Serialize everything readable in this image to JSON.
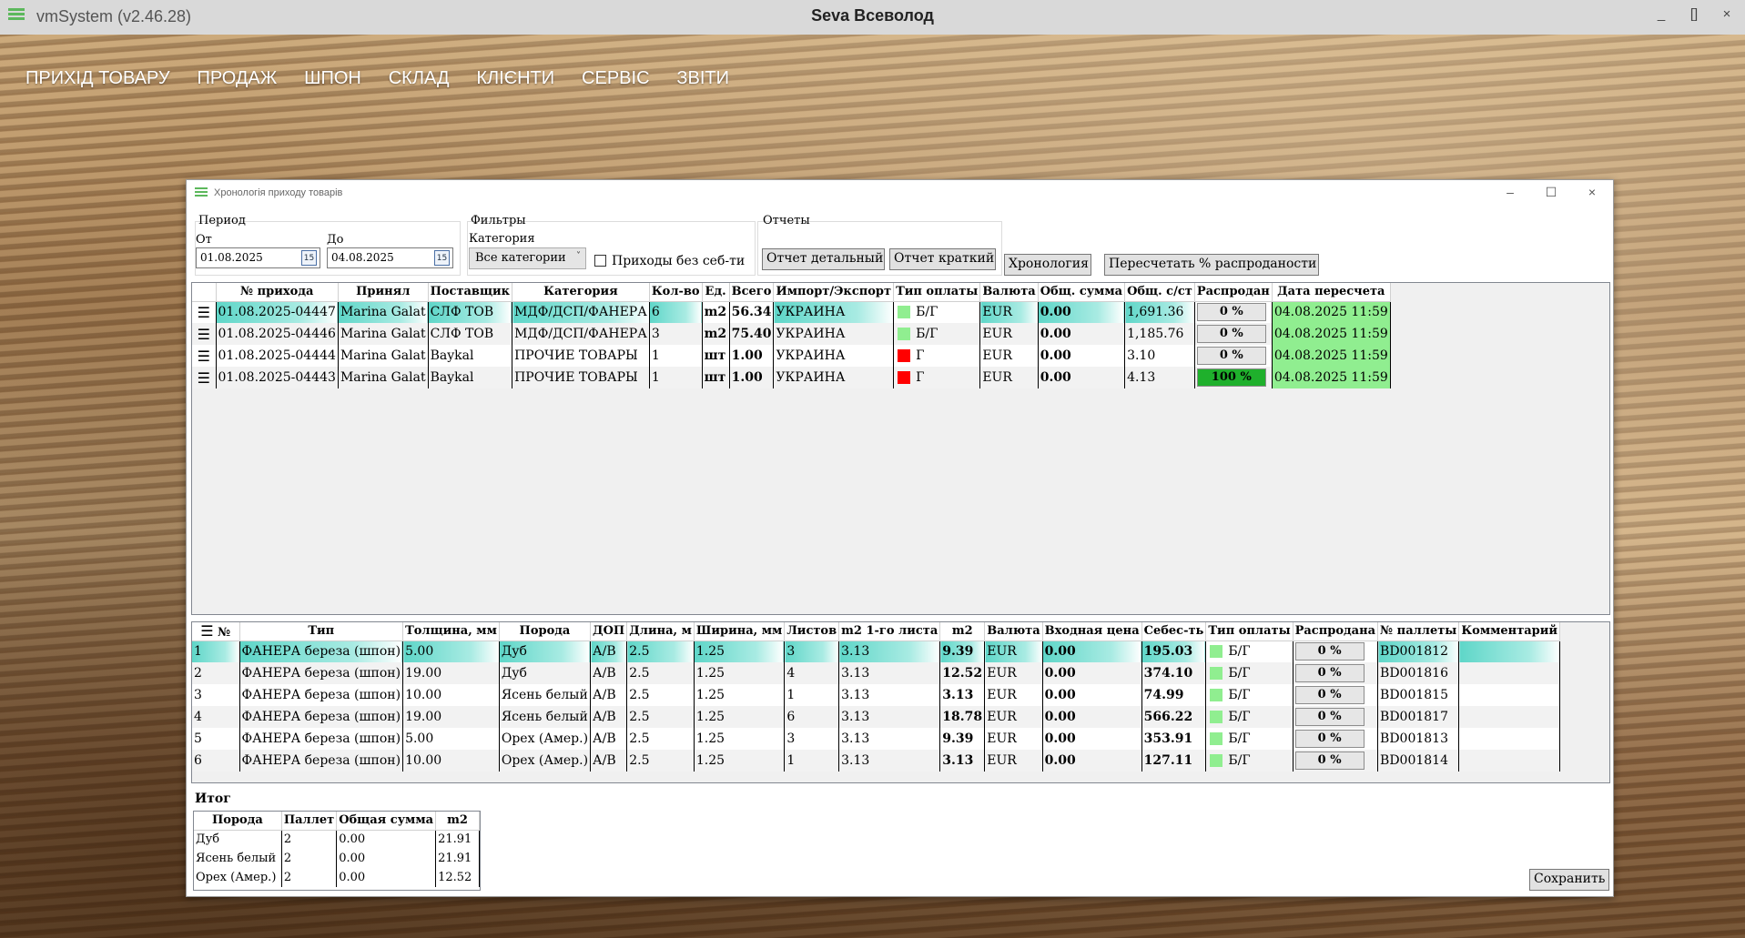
{
  "titlebar": {
    "app_title": "vmSystem (v2.46.28)",
    "user": "Seva Всеволод",
    "minimize": "_",
    "restore": "[]",
    "close": "×"
  },
  "nav": [
    "ПРИХІД ТОВАРУ",
    "ПРОДАЖ",
    "ШПОН",
    "СКЛАД",
    "КЛІЄНТИ",
    "СЕРВІС",
    "ЗВІТИ"
  ],
  "window": {
    "title": "Хронологія приходу товарів",
    "minimize": "–",
    "maximize": "☐",
    "close": "×"
  },
  "period": {
    "label": "Период",
    "from_label": "От",
    "from_value": "01.08.2025",
    "to_label": "До",
    "to_value": "04.08.2025",
    "calendar_icon_text": "15"
  },
  "filters": {
    "label": "Фильтры",
    "category_label": "Категория",
    "category_value": "Все категории",
    "no_cost_label": "Приходы без себ-ти"
  },
  "reports": {
    "label": "Отчеты",
    "detailed": "Отчет детальный",
    "brief": "Отчет краткий"
  },
  "buttons": {
    "chronology": "Хронология",
    "recalc": "Пересчетать % распроданости",
    "save": "Сохранить"
  },
  "receipts": {
    "columns": [
      "№ прихода",
      "Принял",
      "Поставщик",
      "Категория",
      "Кол-во",
      "Ед.",
      "Всего",
      "Импорт/Экспорт",
      "Тип оплаты",
      "Валюта",
      "Общ. сумма",
      "Общ. с/ст",
      "Распродан",
      "Дата пересчета"
    ],
    "rows": [
      {
        "id": "01.08.2025-04447",
        "accepted": "Marina Galat",
        "supplier": "СЛФ ТОВ",
        "category": "МДФ/ДСП/ФАНЕРА",
        "qty": "6",
        "unit": "m2",
        "total": "56.34",
        "ie": "УКРАИНА",
        "pay_color": "#90ee90",
        "pay": "Б/Г",
        "currency": "EUR",
        "sum": "0.00",
        "cost": "1,691.36",
        "sold": "0 %",
        "recalc": "04.08.2025 11:59"
      },
      {
        "id": "01.08.2025-04446",
        "accepted": "Marina Galat",
        "supplier": "СЛФ ТОВ",
        "category": "МДФ/ДСП/ФАНЕРА",
        "qty": "3",
        "unit": "m2",
        "total": "75.40",
        "ie": "УКРАИНА",
        "pay_color": "#90ee90",
        "pay": "Б/Г",
        "currency": "EUR",
        "sum": "0.00",
        "cost": "1,185.76",
        "sold": "0 %",
        "recalc": "04.08.2025 11:59"
      },
      {
        "id": "01.08.2025-04444",
        "accepted": "Marina Galat",
        "supplier": "Baykal",
        "category": "ПРОЧИЕ ТОВАРЫ",
        "qty": "1",
        "unit": "шт",
        "total": "1.00",
        "ie": "УКРАИНА",
        "pay_color": "#ff0000",
        "pay": "Г",
        "currency": "EUR",
        "sum": "0.00",
        "cost": "3.10",
        "sold": "0 %",
        "recalc": "04.08.2025 11:59"
      },
      {
        "id": "01.08.2025-04443",
        "accepted": "Marina Galat",
        "supplier": "Baykal",
        "category": "ПРОЧИЕ ТОВАРЫ",
        "qty": "1",
        "unit": "шт",
        "total": "1.00",
        "ie": "УКРАИНА",
        "pay_color": "#ff0000",
        "pay": "Г",
        "currency": "EUR",
        "sum": "0.00",
        "cost": "4.13",
        "sold": "100 %",
        "recalc": "04.08.2025 11:59"
      }
    ]
  },
  "items": {
    "columns": [
      "№",
      "Тип",
      "Толщина, мм",
      "Порода",
      "ДОП",
      "Длина, м",
      "Ширина, мм",
      "Листов",
      "m2 1-го листа",
      "m2",
      "Валюта",
      "Входная цена",
      "Себес-ть",
      "Тип оплаты",
      "Распродана",
      "№ паллеты",
      "Комментарий"
    ],
    "rows": [
      {
        "n": "1",
        "type": "ФАНЕРА береза (шпон)",
        "thick": "5.00",
        "species": "Дуб",
        "dop": "А/В",
        "len": "2.5",
        "width": "1.25",
        "sheets": "3",
        "m2one": "3.13",
        "m2": "9.39",
        "currency": "EUR",
        "price": "0.00",
        "cost": "195.03",
        "pay": "Б/Г",
        "sold": "0 %",
        "pallet": "BD001812",
        "comment": ""
      },
      {
        "n": "2",
        "type": "ФАНЕРА береза (шпон)",
        "thick": "19.00",
        "species": "Дуб",
        "dop": "А/В",
        "len": "2.5",
        "width": "1.25",
        "sheets": "4",
        "m2one": "3.13",
        "m2": "12.52",
        "currency": "EUR",
        "price": "0.00",
        "cost": "374.10",
        "pay": "Б/Г",
        "sold": "0 %",
        "pallet": "BD001816",
        "comment": ""
      },
      {
        "n": "3",
        "type": "ФАНЕРА береза (шпон)",
        "thick": "10.00",
        "species": "Ясень белый",
        "dop": "А/В",
        "len": "2.5",
        "width": "1.25",
        "sheets": "1",
        "m2one": "3.13",
        "m2": "3.13",
        "currency": "EUR",
        "price": "0.00",
        "cost": "74.99",
        "pay": "Б/Г",
        "sold": "0 %",
        "pallet": "BD001815",
        "comment": ""
      },
      {
        "n": "4",
        "type": "ФАНЕРА береза (шпон)",
        "thick": "19.00",
        "species": "Ясень белый",
        "dop": "А/В",
        "len": "2.5",
        "width": "1.25",
        "sheets": "6",
        "m2one": "3.13",
        "m2": "18.78",
        "currency": "EUR",
        "price": "0.00",
        "cost": "566.22",
        "pay": "Б/Г",
        "sold": "0 %",
        "pallet": "BD001817",
        "comment": ""
      },
      {
        "n": "5",
        "type": "ФАНЕРА береза (шпон)",
        "thick": "5.00",
        "species": "Орех (Амер.)",
        "dop": "А/В",
        "len": "2.5",
        "width": "1.25",
        "sheets": "3",
        "m2one": "3.13",
        "m2": "9.39",
        "currency": "EUR",
        "price": "0.00",
        "cost": "353.91",
        "pay": "Б/Г",
        "sold": "0 %",
        "pallet": "BD001813",
        "comment": ""
      },
      {
        "n": "6",
        "type": "ФАНЕРА береза (шпон)",
        "thick": "10.00",
        "species": "Орех (Амер.)",
        "dop": "А/В",
        "len": "2.5",
        "width": "1.25",
        "sheets": "1",
        "m2one": "3.13",
        "m2": "3.13",
        "currency": "EUR",
        "price": "0.00",
        "cost": "127.11",
        "pay": "Б/Г",
        "sold": "0 %",
        "pallet": "BD001814",
        "comment": ""
      }
    ]
  },
  "summary": {
    "title": "Итог",
    "columns": [
      "Порода",
      "Паллет",
      "Общая сумма",
      "m2"
    ],
    "rows": [
      {
        "species": "Дуб",
        "pallets": "2",
        "sum": "0.00",
        "m2": "21.91"
      },
      {
        "species": "Ясень белый",
        "pallets": "2",
        "sum": "0.00",
        "m2": "21.91"
      },
      {
        "species": "Орех (Амер.)",
        "pallets": "2",
        "sum": "0.00",
        "m2": "12.52"
      }
    ]
  },
  "colors": {
    "highlight_teal": "#5ed6c8",
    "paid_green": "#90ee90",
    "unpaid_red": "#ff0000",
    "sold_full": "#1fb02c",
    "app_icon_green": "#5cb85c"
  }
}
